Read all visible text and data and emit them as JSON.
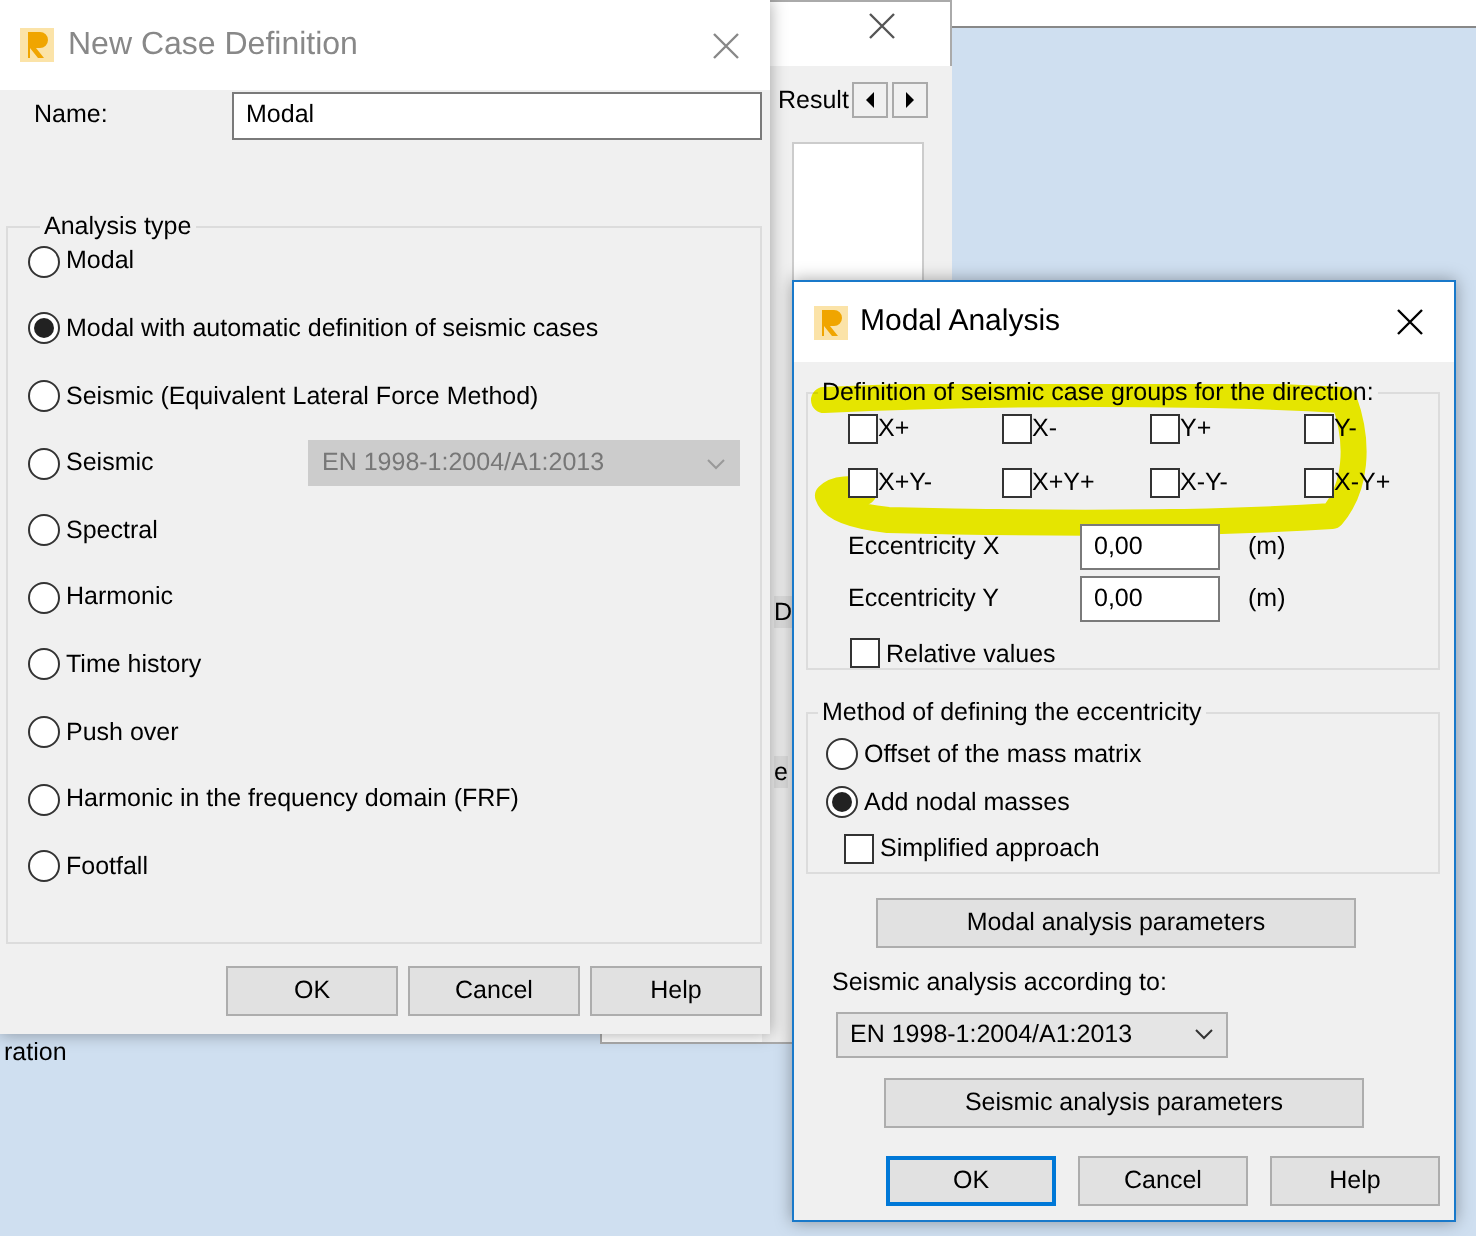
{
  "background_window": {
    "tab": "Result",
    "fragments": [
      "D",
      "e",
      "ration"
    ]
  },
  "case_dialog": {
    "title": "New Case Definition",
    "active": false,
    "name_label": "Name:",
    "name_value": "Modal",
    "group_title": "Analysis type",
    "options": [
      {
        "label": "Modal",
        "selected": false
      },
      {
        "label": "Modal with automatic definition of seismic cases",
        "selected": true
      },
      {
        "label": "Seismic (Equivalent Lateral Force Method)",
        "selected": false
      },
      {
        "label": "Seismic",
        "selected": false,
        "select": {
          "value": "EN 1998-1:2004/A1:2013",
          "disabled": true
        }
      },
      {
        "label": "Spectral",
        "selected": false
      },
      {
        "label": "Harmonic",
        "selected": false
      },
      {
        "label": "Time history",
        "selected": false
      },
      {
        "label": "Push over",
        "selected": false
      },
      {
        "label": "Harmonic in the frequency domain (FRF)",
        "selected": false
      },
      {
        "label": "Footfall",
        "selected": false
      }
    ],
    "buttons": [
      "OK",
      "Cancel",
      "Help"
    ]
  },
  "modal_dialog": {
    "title": "Modal Analysis",
    "active": true,
    "direction_group": {
      "title": "Definition of seismic case groups for the direction:",
      "highlighted": true,
      "directions": [
        {
          "label": "X+",
          "checked": false
        },
        {
          "label": "X-",
          "checked": false
        },
        {
          "label": "Y+",
          "checked": false
        },
        {
          "label": "Y-",
          "checked": false
        },
        {
          "label": "X+Y-",
          "checked": false
        },
        {
          "label": "X+Y+",
          "checked": false
        },
        {
          "label": "X-Y-",
          "checked": false
        },
        {
          "label": "X-Y+",
          "checked": false
        }
      ],
      "eccentricities": [
        {
          "label": "Eccentricity X",
          "value": "0,00",
          "unit": "(m)"
        },
        {
          "label": "Eccentricity Y",
          "value": "0,00",
          "unit": "(m)"
        }
      ],
      "relative_values": {
        "label": "Relative values",
        "checked": false
      }
    },
    "method_group": {
      "title": "Method of defining the eccentricity",
      "options": [
        {
          "label": "Offset of the mass matrix",
          "selected": false
        },
        {
          "label": "Add nodal masses",
          "selected": true
        }
      ],
      "simplified": {
        "label": "Simplified approach",
        "checked": false
      }
    },
    "modal_params_button": "Modal analysis parameters",
    "seismic_label": "Seismic analysis according to:",
    "seismic_select": "EN 1998-1:2004/A1:2013",
    "seismic_params_button": "Seismic analysis parameters",
    "buttons": [
      {
        "label": "OK",
        "focused": true
      },
      {
        "label": "Cancel",
        "focused": false
      },
      {
        "label": "Help",
        "focused": false
      }
    ]
  }
}
